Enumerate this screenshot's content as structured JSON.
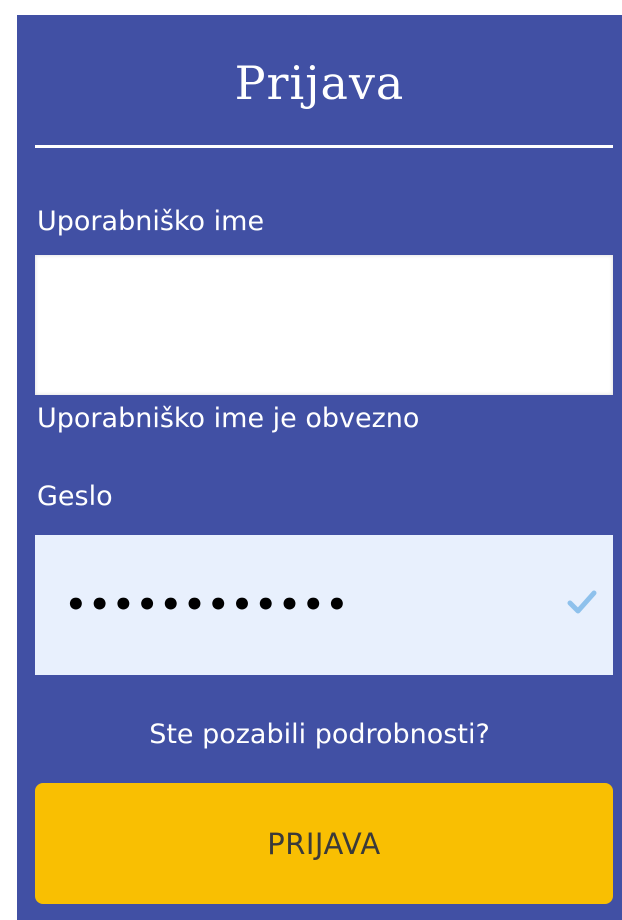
{
  "form": {
    "title": "Prijava",
    "username_label": "Uporabniško ime",
    "username_value": "",
    "username_error": "Uporabniško ime je obvezno",
    "password_label": "Geslo",
    "password_value": "••••••••••••",
    "password_valid_icon": "checkmark-icon",
    "forgot_link": "Ste pozabili podrobnosti?",
    "submit_label": "PRIJAVA"
  },
  "colors": {
    "panel_background": "#4150a4",
    "password_field_background": "#e8f0fd",
    "button_background": "#f9bf02",
    "checkmark": "#8ec1ec"
  }
}
